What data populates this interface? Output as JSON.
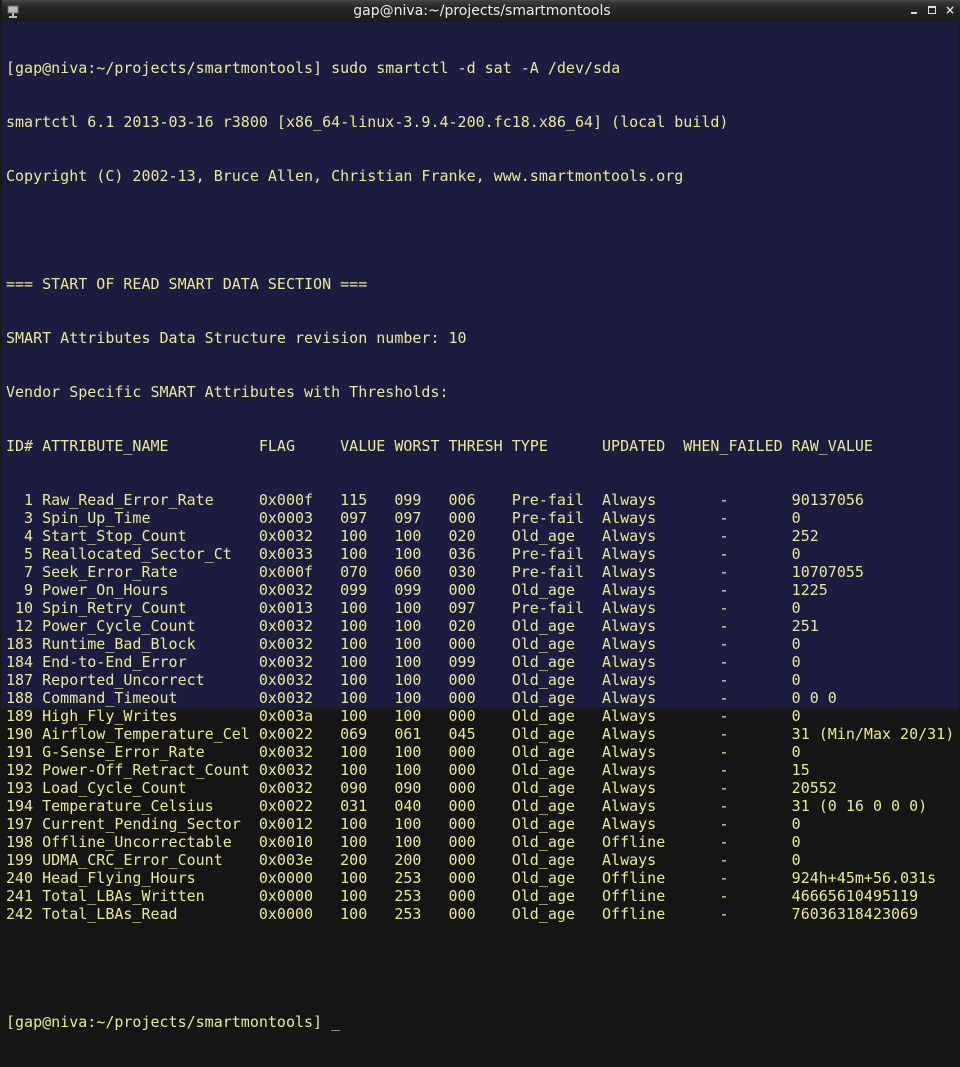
{
  "window": {
    "title": "gap@niva:~/projects/smartmontools",
    "icon": "terminal-icon",
    "controls": {
      "minimize": "minimize-icon",
      "maximize": "maximize-icon",
      "close": "×"
    }
  },
  "terminal": {
    "prompt": "[gap@niva:~/projects/smartmontools]",
    "command": "sudo smartctl -d sat -A /dev/sda",
    "header_lines": [
      "smartctl 6.1 2013-03-16 r3800 [x86_64-linux-3.9.4-200.fc18.x86_64] (local build)",
      "Copyright (C) 2002-13, Bruce Allen, Christian Franke, www.smartmontools.org",
      "",
      "=== START OF READ SMART DATA SECTION ===",
      "SMART Attributes Data Structure revision number: 10",
      "Vendor Specific SMART Attributes with Thresholds:"
    ],
    "table": {
      "columns": [
        "ID#",
        "ATTRIBUTE_NAME",
        "FLAG",
        "VALUE",
        "WORST",
        "THRESH",
        "TYPE",
        "UPDATED",
        "WHEN_FAILED",
        "RAW_VALUE"
      ],
      "rows": [
        [
          "1",
          "Raw_Read_Error_Rate",
          "0x000f",
          "115",
          "099",
          "006",
          "Pre-fail",
          "Always",
          "-",
          "90137056"
        ],
        [
          "3",
          "Spin_Up_Time",
          "0x0003",
          "097",
          "097",
          "000",
          "Pre-fail",
          "Always",
          "-",
          "0"
        ],
        [
          "4",
          "Start_Stop_Count",
          "0x0032",
          "100",
          "100",
          "020",
          "Old_age",
          "Always",
          "-",
          "252"
        ],
        [
          "5",
          "Reallocated_Sector_Ct",
          "0x0033",
          "100",
          "100",
          "036",
          "Pre-fail",
          "Always",
          "-",
          "0"
        ],
        [
          "7",
          "Seek_Error_Rate",
          "0x000f",
          "070",
          "060",
          "030",
          "Pre-fail",
          "Always",
          "-",
          "10707055"
        ],
        [
          "9",
          "Power_On_Hours",
          "0x0032",
          "099",
          "099",
          "000",
          "Old_age",
          "Always",
          "-",
          "1225"
        ],
        [
          "10",
          "Spin_Retry_Count",
          "0x0013",
          "100",
          "100",
          "097",
          "Pre-fail",
          "Always",
          "-",
          "0"
        ],
        [
          "12",
          "Power_Cycle_Count",
          "0x0032",
          "100",
          "100",
          "020",
          "Old_age",
          "Always",
          "-",
          "251"
        ],
        [
          "183",
          "Runtime_Bad_Block",
          "0x0032",
          "100",
          "100",
          "000",
          "Old_age",
          "Always",
          "-",
          "0"
        ],
        [
          "184",
          "End-to-End_Error",
          "0x0032",
          "100",
          "100",
          "099",
          "Old_age",
          "Always",
          "-",
          "0"
        ],
        [
          "187",
          "Reported_Uncorrect",
          "0x0032",
          "100",
          "100",
          "000",
          "Old_age",
          "Always",
          "-",
          "0"
        ],
        [
          "188",
          "Command_Timeout",
          "0x0032",
          "100",
          "100",
          "000",
          "Old_age",
          "Always",
          "-",
          "0 0 0"
        ],
        [
          "189",
          "High_Fly_Writes",
          "0x003a",
          "100",
          "100",
          "000",
          "Old_age",
          "Always",
          "-",
          "0"
        ],
        [
          "190",
          "Airflow_Temperature_Cel",
          "0x0022",
          "069",
          "061",
          "045",
          "Old_age",
          "Always",
          "-",
          "31 (Min/Max 20/31)"
        ],
        [
          "191",
          "G-Sense_Error_Rate",
          "0x0032",
          "100",
          "100",
          "000",
          "Old_age",
          "Always",
          "-",
          "0"
        ],
        [
          "192",
          "Power-Off_Retract_Count",
          "0x0032",
          "100",
          "100",
          "000",
          "Old_age",
          "Always",
          "-",
          "15"
        ],
        [
          "193",
          "Load_Cycle_Count",
          "0x0032",
          "090",
          "090",
          "000",
          "Old_age",
          "Always",
          "-",
          "20552"
        ],
        [
          "194",
          "Temperature_Celsius",
          "0x0022",
          "031",
          "040",
          "000",
          "Old_age",
          "Always",
          "-",
          "31 (0 16 0 0 0)"
        ],
        [
          "197",
          "Current_Pending_Sector",
          "0x0012",
          "100",
          "100",
          "000",
          "Old_age",
          "Always",
          "-",
          "0"
        ],
        [
          "198",
          "Offline_Uncorrectable",
          "0x0010",
          "100",
          "100",
          "000",
          "Old_age",
          "Offline",
          "-",
          "0"
        ],
        [
          "199",
          "UDMA_CRC_Error_Count",
          "0x003e",
          "200",
          "200",
          "000",
          "Old_age",
          "Always",
          "-",
          "0"
        ],
        [
          "240",
          "Head_Flying_Hours",
          "0x0000",
          "100",
          "253",
          "000",
          "Old_age",
          "Offline",
          "-",
          "924h+45m+56.031s"
        ],
        [
          "241",
          "Total_LBAs_Written",
          "0x0000",
          "100",
          "253",
          "000",
          "Old_age",
          "Offline",
          "-",
          "46665610495119"
        ],
        [
          "242",
          "Total_LBAs_Read",
          "0x0000",
          "100",
          "253",
          "000",
          "Old_age",
          "Offline",
          "-",
          "76036318423069"
        ]
      ]
    },
    "cursor": "_"
  },
  "colors": {
    "terminal_bg": "#1b1c3f",
    "terminal_fg": "#eaea96",
    "titlebar_fg": "#ececec"
  }
}
